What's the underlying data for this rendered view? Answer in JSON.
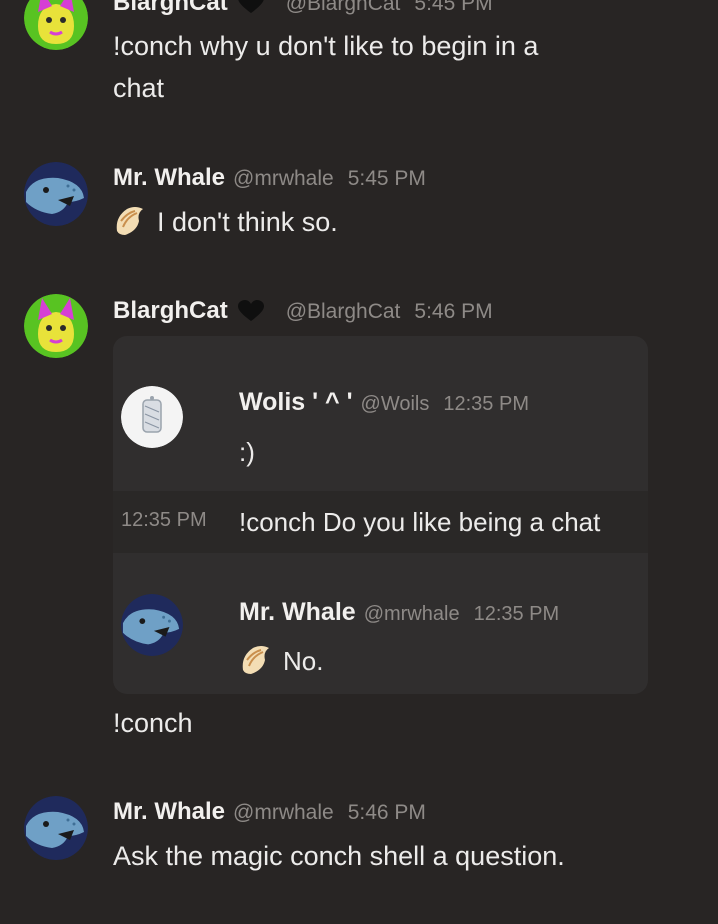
{
  "messages": [
    {
      "author": "BlarghCat",
      "handle": "@BlarghCat",
      "time": "5:45 PM",
      "text_line1": "!conch why u don't like to begin in a",
      "text_line2": "chat"
    },
    {
      "author": "Mr. Whale",
      "handle": "@mrwhale",
      "time": "5:45 PM",
      "text": "I don't think so."
    },
    {
      "author": "BlarghCat",
      "handle": "@BlarghCat",
      "time": "5:46 PM",
      "text": "!conch"
    },
    {
      "author": "Mr. Whale",
      "handle": "@mrwhale",
      "time": "5:46 PM",
      "text": "Ask the magic conch shell a question."
    }
  ],
  "embed": {
    "first": {
      "author": "Wolis ' ^ '",
      "handle": "@Woils",
      "time": "12:35 PM",
      "text": ":)"
    },
    "followup": {
      "time": "12:35 PM",
      "text": "!conch Do you like being a chat"
    },
    "reply": {
      "author": "Mr. Whale",
      "handle": "@mrwhale",
      "time": "12:35 PM",
      "text": "No."
    }
  },
  "colors": {
    "background": "#282524",
    "embed_background": "#302e2e",
    "text": "#ecebea",
    "muted": "#8e8a87"
  },
  "icons": {
    "badge": "black-heart-icon",
    "bot_prefix": "conch-shell-icon"
  }
}
